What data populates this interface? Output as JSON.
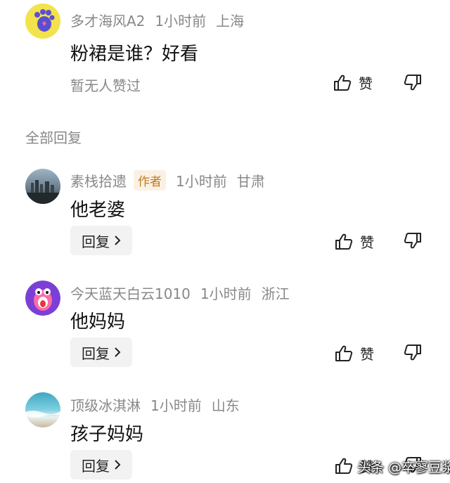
{
  "top_comment": {
    "username": "多才海风A2",
    "time": "1小时前",
    "location": "上海",
    "content": "粉裙是谁？好看",
    "likes_text": "暂无人赞过",
    "like_label": "赞"
  },
  "section_title": "全部回复",
  "replies": [
    {
      "username": "素栈拾遗",
      "badge": "作者",
      "time": "1小时前",
      "location": "甘肃",
      "content": "他老婆",
      "reply_label": "回复",
      "like_label": "赞"
    },
    {
      "username": "今天蓝天白云1010",
      "time": "1小时前",
      "location": "浙江",
      "content": "他妈妈",
      "reply_label": "回复",
      "like_label": "赞"
    },
    {
      "username": "顶级冰淇淋",
      "time": "1小时前",
      "location": "山东",
      "content": "孩子妈妈",
      "reply_label": "回复",
      "like_label": "赞"
    }
  ],
  "watermark": "头条 @卒寥豆浆",
  "colors": {
    "meta_gray": "#888888",
    "badge_text": "#c07a1e",
    "badge_bg": "#fbf1e3",
    "button_bg": "#f2f2f2"
  }
}
